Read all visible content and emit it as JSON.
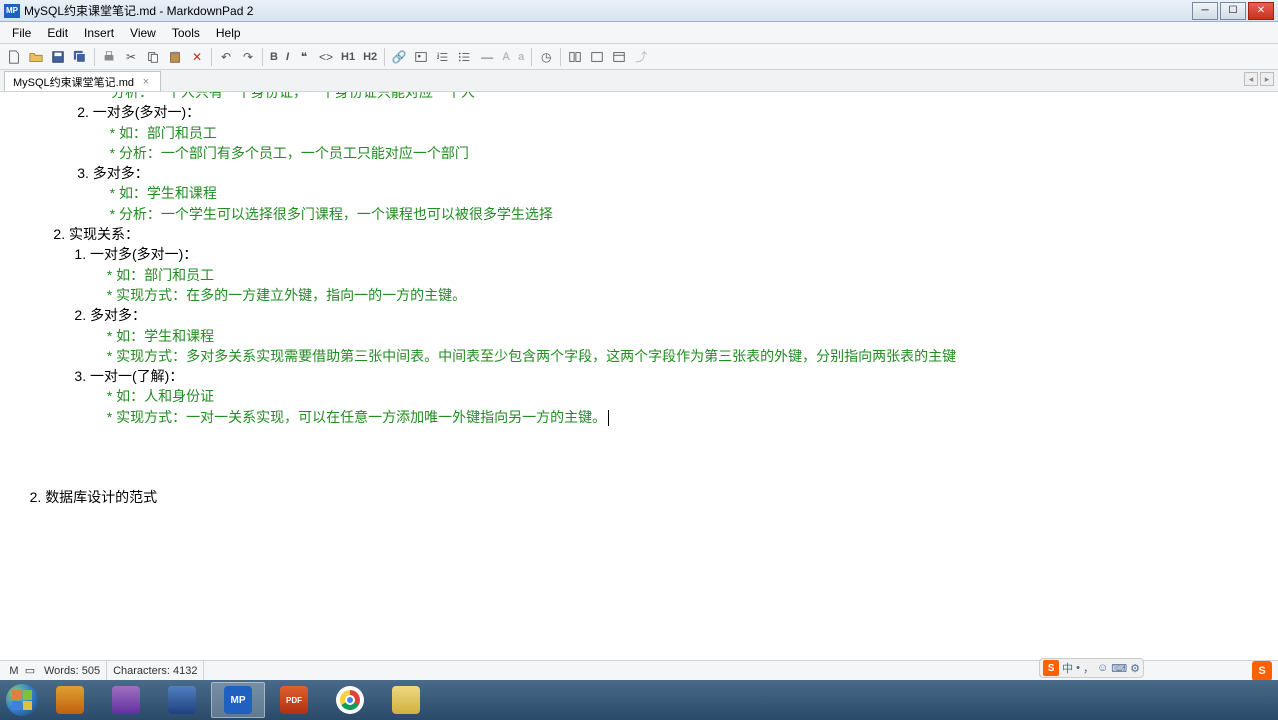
{
  "window": {
    "title": "MySQL约束课堂笔记.md - MarkdownPad 2",
    "app_badge": "MP"
  },
  "menu": {
    "file": "File",
    "edit": "Edit",
    "insert": "Insert",
    "view": "View",
    "tools": "Tools",
    "help": "Help"
  },
  "toolbar": {
    "h1": "H1",
    "h2": "H2",
    "a_upper": "A",
    "a_lower": "a"
  },
  "tab": {
    "label": "MySQL约束课堂笔记.md"
  },
  "content": {
    "cut_line": "分析：一个人只有一个身份证，一个身份证只能对应一个人",
    "s1": {
      "item2": "一对多(多对一)：",
      "item2_a": "如：部门和员工",
      "item2_b": "分析：一个部门有多个员工，一个员工只能对应一个部门",
      "item3": "多对多：",
      "item3_a": "如：学生和课程",
      "item3_b": "分析：一个学生可以选择很多门课程，一个课程也可以被很多学生选择"
    },
    "h2_label": "实现关系：",
    "s2": {
      "item1": "一对多(多对一)：",
      "item1_a": "如：部门和员工",
      "item1_b": "实现方式：在多的一方建立外键，指向一的一方的主键。",
      "item2": "多对多：",
      "item2_a": "如：学生和课程",
      "item2_b": "实现方式：多对多关系实现需要借助第三张中间表。中间表至少包含两个字段，这两个字段作为第三张表的外键，分别指向两张表的主键",
      "item3": "一对一(了解)：",
      "item3_a": "如：人和身份证",
      "item3_b": "实现方式：一对一关系实现，可以在任意一方添加唯一外键指向另一方的主键。"
    },
    "bottom": "数据库设计的范式"
  },
  "status": {
    "words_label": "Words:",
    "words_value": "505",
    "chars_label": "Characters:",
    "chars_value": "4132"
  },
  "ime": {
    "badge": "S",
    "zhong": "中",
    "dot": "•",
    "comma": "，",
    "smile": "☺",
    "keyb": "⌨",
    "gear": "⚙"
  },
  "taskbar": {
    "mp": "MP",
    "pdf": "PDF"
  }
}
